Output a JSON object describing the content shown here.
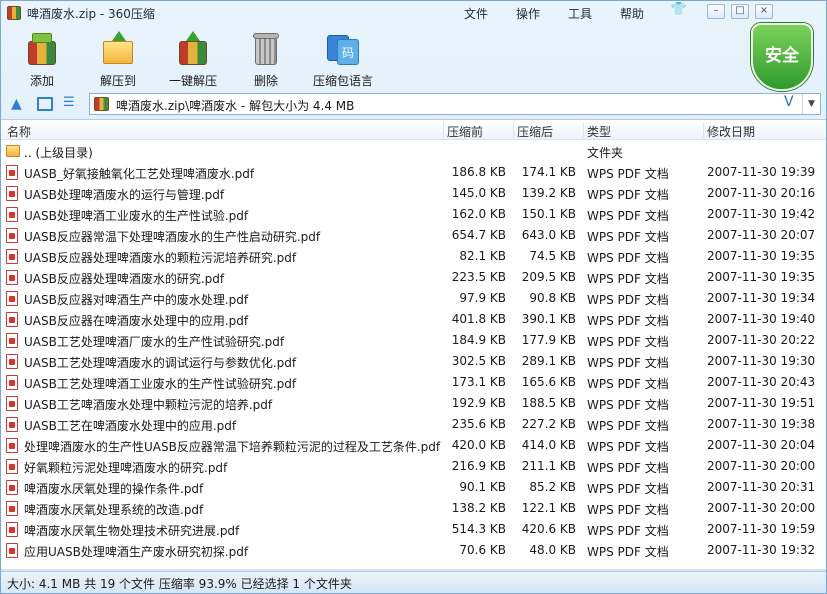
{
  "window": {
    "title": "啤酒废水.zip - 360压缩",
    "menu": {
      "file": "文件",
      "operation": "操作",
      "tools": "工具",
      "help": "帮助"
    },
    "controls": {
      "minimize": "–",
      "maximize": "□",
      "close": "×"
    }
  },
  "toolbar": {
    "add": "添加",
    "extract": "解压到",
    "one_click_extract": "一键解压",
    "delete": "删除",
    "language": "压缩包语言",
    "lang_icon_char": "码"
  },
  "safety_badge": "安全",
  "address": {
    "path": "啤酒废水.zip\\啤酒废水 - 解包大小为 4.4 MB",
    "fav_char": "V",
    "drop_char": "▼"
  },
  "columns": {
    "name": "名称",
    "before": "压缩前",
    "after": "压缩后",
    "type": "类型",
    "date": "修改日期"
  },
  "parent_row": {
    "name": ".. (上级目录)",
    "type": "文件夹"
  },
  "files": [
    {
      "name": "UASB_好氧接触氧化工艺处理啤酒废水.pdf",
      "before": "186.8 KB",
      "after": "174.1 KB",
      "type": "WPS PDF 文档",
      "date": "2007-11-30 19:39"
    },
    {
      "name": "UASB处理啤酒废水的运行与管理.pdf",
      "before": "145.0 KB",
      "after": "139.2 KB",
      "type": "WPS PDF 文档",
      "date": "2007-11-30 20:16"
    },
    {
      "name": "UASB处理啤酒工业废水的生产性试验.pdf",
      "before": "162.0 KB",
      "after": "150.1 KB",
      "type": "WPS PDF 文档",
      "date": "2007-11-30 19:42"
    },
    {
      "name": "UASB反应器常温下处理啤酒废水的生产性启动研究.pdf",
      "before": "654.7 KB",
      "after": "643.0 KB",
      "type": "WPS PDF 文档",
      "date": "2007-11-30 20:07"
    },
    {
      "name": "UASB反应器处理啤酒废水的颗粒污泥培养研究.pdf",
      "before": "82.1 KB",
      "after": "74.5 KB",
      "type": "WPS PDF 文档",
      "date": "2007-11-30 19:35"
    },
    {
      "name": "UASB反应器处理啤酒废水的研究.pdf",
      "before": "223.5 KB",
      "after": "209.5 KB",
      "type": "WPS PDF 文档",
      "date": "2007-11-30 19:35"
    },
    {
      "name": "UASB反应器对啤酒生产中的废水处理.pdf",
      "before": "97.9 KB",
      "after": "90.8 KB",
      "type": "WPS PDF 文档",
      "date": "2007-11-30 19:34"
    },
    {
      "name": "UASB反应器在啤酒废水处理中的应用.pdf",
      "before": "401.8 KB",
      "after": "390.1 KB",
      "type": "WPS PDF 文档",
      "date": "2007-11-30 19:40"
    },
    {
      "name": "UASB工艺处理啤酒厂废水的生产性试验研究.pdf",
      "before": "184.9 KB",
      "after": "177.9 KB",
      "type": "WPS PDF 文档",
      "date": "2007-11-30 20:22"
    },
    {
      "name": "UASB工艺处理啤酒废水的调试运行与参数优化.pdf",
      "before": "302.5 KB",
      "after": "289.1 KB",
      "type": "WPS PDF 文档",
      "date": "2007-11-30 19:30"
    },
    {
      "name": "UASB工艺处理啤酒工业废水的生产性试验研究.pdf",
      "before": "173.1 KB",
      "after": "165.6 KB",
      "type": "WPS PDF 文档",
      "date": "2007-11-30 20:43"
    },
    {
      "name": "UASB工艺啤酒废水处理中颗粒污泥的培养.pdf",
      "before": "192.9 KB",
      "after": "188.5 KB",
      "type": "WPS PDF 文档",
      "date": "2007-11-30 19:51"
    },
    {
      "name": "UASB工艺在啤酒废水处理中的应用.pdf",
      "before": "235.6 KB",
      "after": "227.2 KB",
      "type": "WPS PDF 文档",
      "date": "2007-11-30 19:38"
    },
    {
      "name": "处理啤酒废水的生产性UASB反应器常温下培养颗粒污泥的过程及工艺条件.pdf",
      "before": "420.0 KB",
      "after": "414.0 KB",
      "type": "WPS PDF 文档",
      "date": "2007-11-30 20:04"
    },
    {
      "name": "好氧颗粒污泥处理啤酒废水的研究.pdf",
      "before": "216.9 KB",
      "after": "211.1 KB",
      "type": "WPS PDF 文档",
      "date": "2007-11-30 20:00"
    },
    {
      "name": "啤酒废水厌氧处理的操作条件.pdf",
      "before": "90.1 KB",
      "after": "85.2 KB",
      "type": "WPS PDF 文档",
      "date": "2007-11-30 20:31"
    },
    {
      "name": "啤酒废水厌氧处理系统的改造.pdf",
      "before": "138.2 KB",
      "after": "122.1 KB",
      "type": "WPS PDF 文档",
      "date": "2007-11-30 20:00"
    },
    {
      "name": "啤酒废水厌氧生物处理技术研究进展.pdf",
      "before": "514.3 KB",
      "after": "420.6 KB",
      "type": "WPS PDF 文档",
      "date": "2007-11-30 19:59"
    },
    {
      "name": "应用UASB处理啤酒生产废水研究初探.pdf",
      "before": "70.6 KB",
      "after": "48.0 KB",
      "type": "WPS PDF 文档",
      "date": "2007-11-30 19:32"
    }
  ],
  "status": "大小: 4.1 MB 共 19 个文件 压缩率 93.9% 已经选择 1 个文件夹"
}
